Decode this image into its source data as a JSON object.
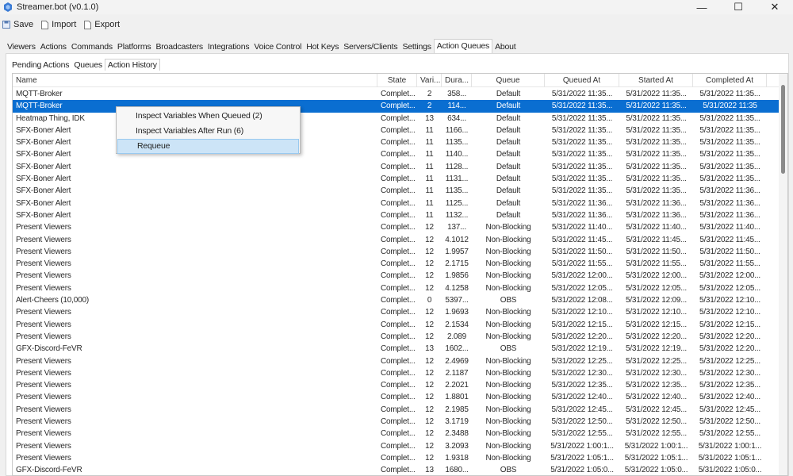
{
  "window": {
    "title": "Streamer.bot (v0.1.0)",
    "minimize": "—",
    "maximize": "☐",
    "close": "✕"
  },
  "toolbar": {
    "save": "Save",
    "import": "Import",
    "export": "Export"
  },
  "tabs": [
    "Viewers",
    "Actions",
    "Commands",
    "Platforms",
    "Broadcasters",
    "Integrations",
    "Voice Control",
    "Hot Keys",
    "Servers/Clients",
    "Settings",
    "Action Queues",
    "About"
  ],
  "active_tab": "Action Queues",
  "subtabs": [
    "Pending Actions",
    "Queues",
    "Action History"
  ],
  "active_subtab": "Action History",
  "columns": [
    "Name",
    "State",
    "Vari...",
    "Dura...",
    "Queue",
    "Queued At",
    "Started At",
    "Completed At"
  ],
  "rows": [
    [
      "MQTT-Broker",
      "Complet...",
      "2",
      "358...",
      "Default",
      "5/31/2022 11:35...",
      "5/31/2022 11:35...",
      "5/31/2022 11:35..."
    ],
    [
      "MQTT-Broker",
      "Complet...",
      "2",
      "114...",
      "Default",
      "5/31/2022 11:35...",
      "5/31/2022 11:35...",
      "5/31/2022 11:35"
    ],
    [
      "Heatmap Thing, IDK",
      "Complet...",
      "13",
      "634...",
      "Default",
      "5/31/2022 11:35...",
      "5/31/2022 11:35...",
      "5/31/2022 11:35..."
    ],
    [
      "SFX-Boner Alert",
      "Complet...",
      "11",
      "1166...",
      "Default",
      "5/31/2022 11:35...",
      "5/31/2022 11:35...",
      "5/31/2022 11:35..."
    ],
    [
      "SFX-Boner Alert",
      "Complet...",
      "11",
      "1135...",
      "Default",
      "5/31/2022 11:35...",
      "5/31/2022 11:35...",
      "5/31/2022 11:35..."
    ],
    [
      "SFX-Boner Alert",
      "Complet...",
      "11",
      "1140...",
      "Default",
      "5/31/2022 11:35...",
      "5/31/2022 11:35...",
      "5/31/2022 11:35..."
    ],
    [
      "SFX-Boner Alert",
      "Complet...",
      "11",
      "1128...",
      "Default",
      "5/31/2022 11:35...",
      "5/31/2022 11:35...",
      "5/31/2022 11:35..."
    ],
    [
      "SFX-Boner Alert",
      "Complet...",
      "11",
      "1131...",
      "Default",
      "5/31/2022 11:35...",
      "5/31/2022 11:35...",
      "5/31/2022 11:35..."
    ],
    [
      "SFX-Boner Alert",
      "Complet...",
      "11",
      "1135...",
      "Default",
      "5/31/2022 11:35...",
      "5/31/2022 11:35...",
      "5/31/2022 11:36..."
    ],
    [
      "SFX-Boner Alert",
      "Complet...",
      "11",
      "1125...",
      "Default",
      "5/31/2022 11:36...",
      "5/31/2022 11:36...",
      "5/31/2022 11:36..."
    ],
    [
      "SFX-Boner Alert",
      "Complet...",
      "11",
      "1132...",
      "Default",
      "5/31/2022 11:36...",
      "5/31/2022 11:36...",
      "5/31/2022 11:36..."
    ],
    [
      "Present Viewers",
      "Complet...",
      "12",
      "137...",
      "Non-Blocking",
      "5/31/2022 11:40...",
      "5/31/2022 11:40...",
      "5/31/2022 11:40..."
    ],
    [
      "Present Viewers",
      "Complet...",
      "12",
      "4.1012",
      "Non-Blocking",
      "5/31/2022 11:45...",
      "5/31/2022 11:45...",
      "5/31/2022 11:45..."
    ],
    [
      "Present Viewers",
      "Complet...",
      "12",
      "1.9957",
      "Non-Blocking",
      "5/31/2022 11:50...",
      "5/31/2022 11:50...",
      "5/31/2022 11:50..."
    ],
    [
      "Present Viewers",
      "Complet...",
      "12",
      "2.1715",
      "Non-Blocking",
      "5/31/2022 11:55...",
      "5/31/2022 11:55...",
      "5/31/2022 11:55..."
    ],
    [
      "Present Viewers",
      "Complet...",
      "12",
      "1.9856",
      "Non-Blocking",
      "5/31/2022 12:00...",
      "5/31/2022 12:00...",
      "5/31/2022 12:00..."
    ],
    [
      "Present Viewers",
      "Complet...",
      "12",
      "4.1258",
      "Non-Blocking",
      "5/31/2022 12:05...",
      "5/31/2022 12:05...",
      "5/31/2022 12:05..."
    ],
    [
      "Alert-Cheers (10,000)",
      "Complet...",
      "0",
      "5397...",
      "OBS",
      "5/31/2022 12:08...",
      "5/31/2022 12:09...",
      "5/31/2022 12:10..."
    ],
    [
      "Present Viewers",
      "Complet...",
      "12",
      "1.9693",
      "Non-Blocking",
      "5/31/2022 12:10...",
      "5/31/2022 12:10...",
      "5/31/2022 12:10..."
    ],
    [
      "Present Viewers",
      "Complet...",
      "12",
      "2.1534",
      "Non-Blocking",
      "5/31/2022 12:15...",
      "5/31/2022 12:15...",
      "5/31/2022 12:15..."
    ],
    [
      "Present Viewers",
      "Complet...",
      "12",
      "2.089",
      "Non-Blocking",
      "5/31/2022 12:20...",
      "5/31/2022 12:20...",
      "5/31/2022 12:20..."
    ],
    [
      "GFX-Discord-FeVR",
      "Complet...",
      "13",
      "1602...",
      "OBS",
      "5/31/2022 12:19...",
      "5/31/2022 12:19...",
      "5/31/2022 12:20..."
    ],
    [
      "Present Viewers",
      "Complet...",
      "12",
      "2.4969",
      "Non-Blocking",
      "5/31/2022 12:25...",
      "5/31/2022 12:25...",
      "5/31/2022 12:25..."
    ],
    [
      "Present Viewers",
      "Complet...",
      "12",
      "2.1187",
      "Non-Blocking",
      "5/31/2022 12:30...",
      "5/31/2022 12:30...",
      "5/31/2022 12:30..."
    ],
    [
      "Present Viewers",
      "Complet...",
      "12",
      "2.2021",
      "Non-Blocking",
      "5/31/2022 12:35...",
      "5/31/2022 12:35...",
      "5/31/2022 12:35..."
    ],
    [
      "Present Viewers",
      "Complet...",
      "12",
      "1.8801",
      "Non-Blocking",
      "5/31/2022 12:40...",
      "5/31/2022 12:40...",
      "5/31/2022 12:40..."
    ],
    [
      "Present Viewers",
      "Complet...",
      "12",
      "2.1985",
      "Non-Blocking",
      "5/31/2022 12:45...",
      "5/31/2022 12:45...",
      "5/31/2022 12:45..."
    ],
    [
      "Present Viewers",
      "Complet...",
      "12",
      "3.1719",
      "Non-Blocking",
      "5/31/2022 12:50...",
      "5/31/2022 12:50...",
      "5/31/2022 12:50..."
    ],
    [
      "Present Viewers",
      "Complet...",
      "12",
      "2.3488",
      "Non-Blocking",
      "5/31/2022 12:55...",
      "5/31/2022 12:55...",
      "5/31/2022 12:55..."
    ],
    [
      "Present Viewers",
      "Complet...",
      "12",
      "3.2093",
      "Non-Blocking",
      "5/31/2022 1:00:1...",
      "5/31/2022 1:00:1...",
      "5/31/2022 1:00:1..."
    ],
    [
      "Present Viewers",
      "Complet...",
      "12",
      "1.9318",
      "Non-Blocking",
      "5/31/2022 1:05:1...",
      "5/31/2022 1:05:1...",
      "5/31/2022 1:05:1..."
    ],
    [
      "GFX-Discord-FeVR",
      "Complet...",
      "13",
      "1680...",
      "OBS",
      "5/31/2022 1:05:0...",
      "5/31/2022 1:05:0...",
      "5/31/2022 1:05:0..."
    ]
  ],
  "selected_row": 1,
  "context_menu": {
    "items": [
      "Inspect Variables When Queued (2)",
      "Inspect Variables After Run (6)",
      "Requeue"
    ],
    "highlighted": "Requeue"
  },
  "colors": {
    "selection": "#0a6ed1",
    "menu_highlight": "#cce4f7"
  }
}
